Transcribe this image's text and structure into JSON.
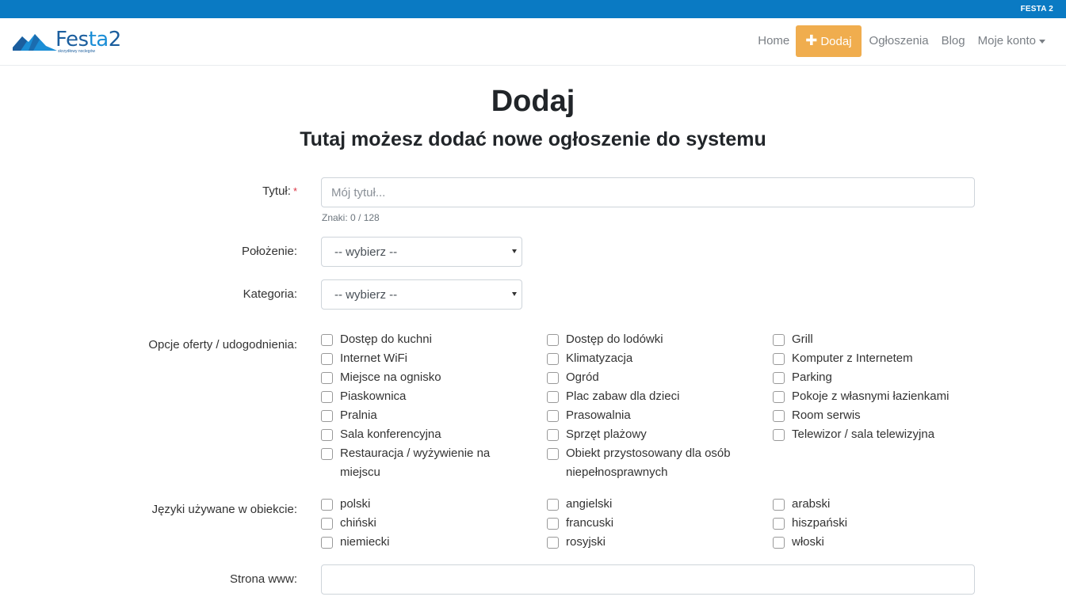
{
  "topbar": {
    "text": "FESTA 2"
  },
  "logo": {
    "brand_part1": "Fes",
    "brand_part2": "ta",
    "brand_part3": "2",
    "tagline": "skrzydłowy noclegów"
  },
  "nav": {
    "items": [
      {
        "label": "Home"
      },
      {
        "label": "Dodaj"
      },
      {
        "label": "Ogłoszenia"
      },
      {
        "label": "Blog"
      },
      {
        "label": "Moje konto"
      }
    ]
  },
  "page": {
    "title": "Dodaj",
    "subtitle": "Tutaj możesz dodać nowe ogłoszenie do systemu"
  },
  "form": {
    "title_label": "Tytuł:",
    "required_mark": "*",
    "title_placeholder": "Mój tytuł...",
    "title_value": "",
    "title_hint": "Znaki: 0 / 128",
    "location_label": "Położenie:",
    "location_value": "-- wybierz --",
    "category_label": "Kategoria:",
    "category_value": "-- wybierz --",
    "options_label": "Opcje oferty / udogodnienia:",
    "options": [
      [
        "Dostęp do kuchni",
        "Dostęp do lodówki",
        "Grill"
      ],
      [
        "Internet WiFi",
        "Klimatyzacja",
        "Komputer z Internetem"
      ],
      [
        "Miejsce na ognisko",
        "Ogród",
        "Parking"
      ],
      [
        "Piaskownica",
        "Plac zabaw dla dzieci",
        "Pokoje z własnymi łazienkami"
      ],
      [
        "Pralnia",
        "Prasowalnia",
        "Room serwis"
      ],
      [
        "Sala konferencyjna",
        "Sprzęt plażowy",
        "Telewizor / sala telewizyjna"
      ],
      [
        "Restauracja / wyżywienie na miejscu",
        "Obiekt przystosowany dla osób niepełnosprawnych",
        ""
      ]
    ],
    "languages_label": "Języki używane w obiekcie:",
    "languages": [
      [
        "polski",
        "angielski",
        "arabski"
      ],
      [
        "chiński",
        "francuski",
        "hiszpański"
      ],
      [
        "niemiecki",
        "rosyjski",
        "włoski"
      ]
    ],
    "website_label": "Strona www:",
    "website_value": ""
  }
}
